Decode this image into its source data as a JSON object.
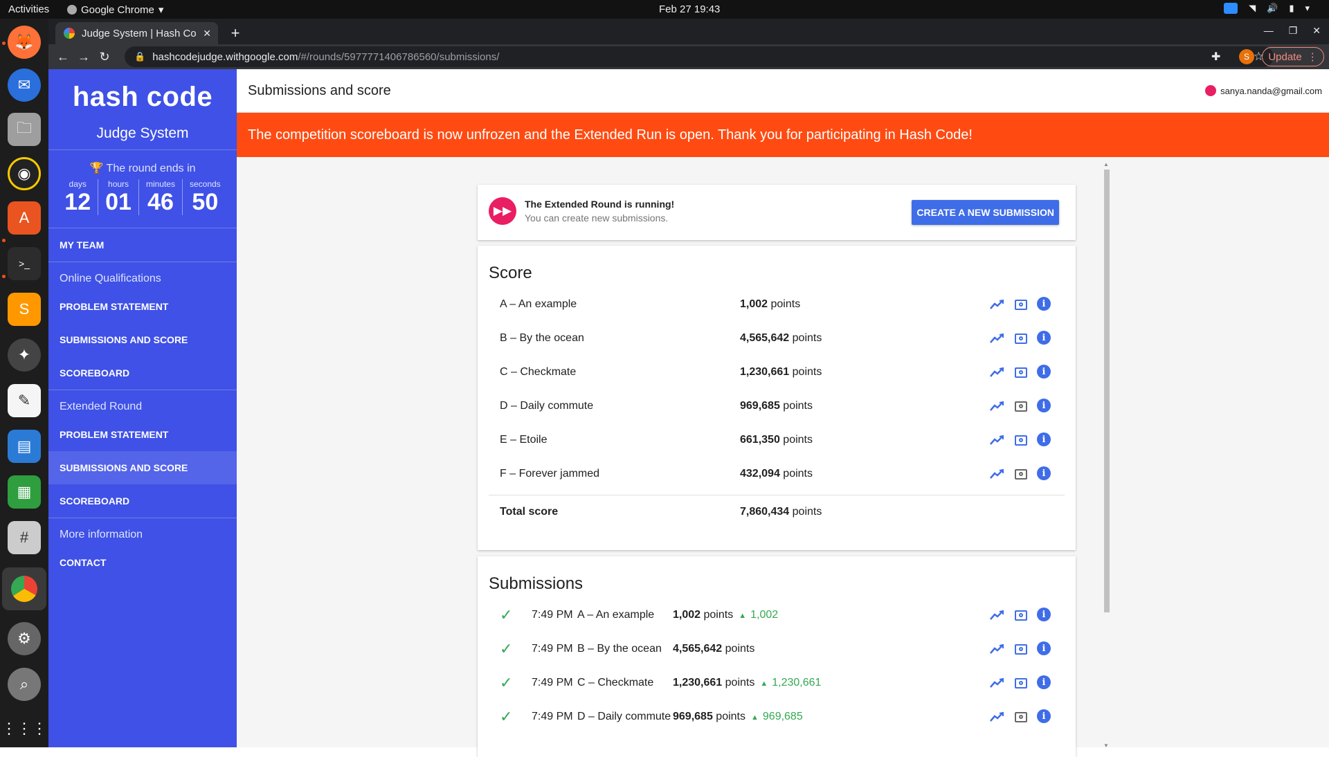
{
  "os": {
    "activities": "Activities",
    "app_name": "Google Chrome",
    "clock": "Feb 27  19:43"
  },
  "browser": {
    "tab_title": "Judge System | Hash Code",
    "url_host": "hashcodejudge.withgoogle.com",
    "url_path": "/#/rounds/5977771406786560/submissions/",
    "profile_initial": "S",
    "update_label": "Update"
  },
  "sidebar": {
    "logo": "hash code",
    "subtitle": "Judge System",
    "countdown_label": "🏆 The round ends in",
    "countdown": [
      {
        "unit": "days",
        "value": "12"
      },
      {
        "unit": "hours",
        "value": "01"
      },
      {
        "unit": "minutes",
        "value": "46"
      },
      {
        "unit": "seconds",
        "value": "50"
      }
    ],
    "my_team": "MY TEAM",
    "section_online": "Online Qualifications",
    "online_items": [
      "PROBLEM STATEMENT",
      "SUBMISSIONS AND SCORE",
      "SCOREBOARD"
    ],
    "section_extended": "Extended Round",
    "extended_items": [
      "PROBLEM STATEMENT",
      "SUBMISSIONS AND SCORE",
      "SCOREBOARD"
    ],
    "section_more": "More information",
    "contact": "CONTACT"
  },
  "header": {
    "title": "Submissions and score",
    "user_email": "sanya.nanda@gmail.com"
  },
  "banner": {
    "text": "The competition scoreboard is now unfrozen and the Extended Run is open. Thank you for participating in Hash Code!"
  },
  "status": {
    "title": "The Extended Round is running!",
    "subtitle": "You can create new submissions.",
    "button": "CREATE A NEW SUBMISSION"
  },
  "score": {
    "title": "Score",
    "unit": "points",
    "rows": [
      {
        "name": "A – An example",
        "points": "1,002",
        "view_icon_grey": false
      },
      {
        "name": "B – By the ocean",
        "points": "4,565,642",
        "view_icon_grey": false
      },
      {
        "name": "C – Checkmate",
        "points": "1,230,661",
        "view_icon_grey": false
      },
      {
        "name": "D – Daily commute",
        "points": "969,685",
        "view_icon_grey": true
      },
      {
        "name": "E – Etoile",
        "points": "661,350",
        "view_icon_grey": false
      },
      {
        "name": "F – Forever jammed",
        "points": "432,094",
        "view_icon_grey": true
      }
    ],
    "total_label": "Total score",
    "total_points": "7,860,434"
  },
  "submissions": {
    "title": "Submissions",
    "unit": "points",
    "rows": [
      {
        "time": "7:49 PM",
        "name": "A – An example",
        "points": "1,002",
        "delta": "1,002",
        "view_icon_grey": false
      },
      {
        "time": "7:49 PM",
        "name": "B – By the ocean",
        "points": "4,565,642",
        "delta": "",
        "view_icon_grey": false
      },
      {
        "time": "7:49 PM",
        "name": "C – Checkmate",
        "points": "1,230,661",
        "delta": "1,230,661",
        "view_icon_grey": false
      },
      {
        "time": "7:49 PM",
        "name": "D – Daily commute",
        "points": "969,685",
        "delta": "969,685",
        "view_icon_grey": true
      }
    ]
  }
}
